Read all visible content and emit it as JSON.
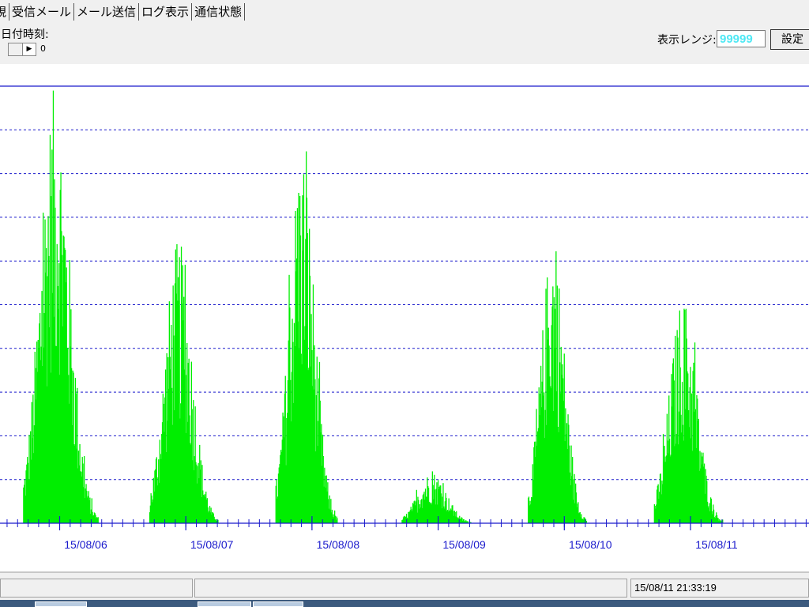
{
  "tabs": [
    "視",
    "受信メール",
    "メール送信",
    "ログ表示",
    "通信状態"
  ],
  "toolbar": {
    "datetime_label": "日付時刻:",
    "spin_value": "0",
    "range_label": "表示レンジ:",
    "range_value": "99999",
    "set_button": "設定"
  },
  "status": {
    "timestamp": "15/08/11 21:33:19"
  },
  "colors": {
    "bars": "#00ee00",
    "grid": "#1a1acc",
    "axis_labels": "#1a1acc",
    "range_text": "#4de8f4"
  },
  "chart_data": {
    "type": "bar",
    "x_tick_labels": [
      "15/08/06",
      "15/08/07",
      "15/08/08",
      "15/08/09",
      "15/08/10",
      "15/08/11"
    ],
    "ylim": [
      0,
      99999
    ],
    "grid": "horizontal dashed",
    "bursts": [
      {
        "date": "15/08/06",
        "start_hour": 0,
        "end_hour": 23,
        "peak": 100000
      },
      {
        "date": "15/08/07",
        "start_hour": 0,
        "end_hour": 21,
        "peak": 65000
      },
      {
        "date": "15/08/08",
        "start_hour": 0,
        "end_hour": 19,
        "peak": 87000
      },
      {
        "date": "15/08/09",
        "start_hour": 0,
        "end_hour": 22,
        "peak": 12000
      },
      {
        "date": "15/08/10",
        "start_hour": 0,
        "end_hour": 18,
        "peak": 66000
      },
      {
        "date": "15/08/11",
        "start_hour": 0,
        "end_hour": 21,
        "peak": 52000
      }
    ]
  }
}
